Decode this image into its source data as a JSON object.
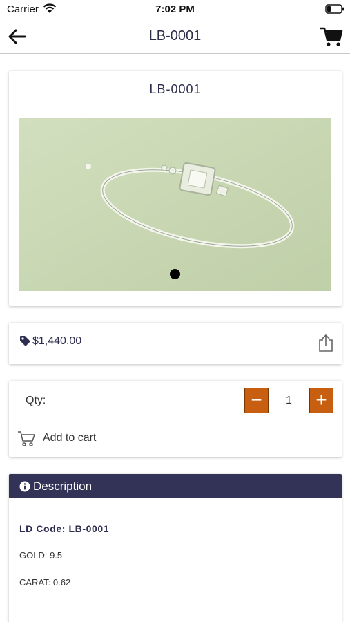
{
  "status_bar": {
    "carrier": "Carrier",
    "time": "7:02 PM"
  },
  "nav": {
    "title": "LB-0001"
  },
  "product": {
    "title": "LB-0001",
    "image_name": "bracelet-image",
    "carousel_pages": 1,
    "carousel_active": 1
  },
  "price": {
    "value": "$1,440.00"
  },
  "quantity": {
    "label": "Qty:",
    "value": "1",
    "minus_label": "−",
    "plus_label": "+"
  },
  "cart": {
    "add_label": "Add to cart"
  },
  "description": {
    "title": "Description",
    "code_line": "LD Code: LB-0001",
    "gold_line": "GOLD:  9.5",
    "carat_line": "CARAT: 0.62"
  },
  "colors": {
    "accent": "#c85f10",
    "header": "#333358",
    "text_dark": "#2e2e50"
  }
}
